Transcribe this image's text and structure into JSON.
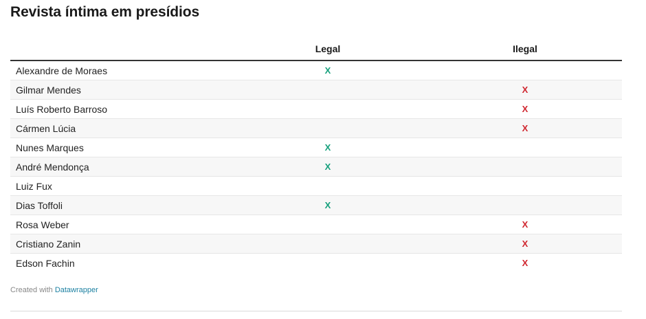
{
  "title": "Revista íntima em presídios",
  "chart_data": {
    "type": "table",
    "columns": [
      "",
      "Legal",
      "Ilegal"
    ],
    "rows": [
      {
        "name": "Alexandre de Moraes",
        "legal": "X",
        "ilegal": ""
      },
      {
        "name": "Gilmar Mendes",
        "legal": "",
        "ilegal": "X"
      },
      {
        "name": "Luís Roberto Barroso",
        "legal": "",
        "ilegal": "X"
      },
      {
        "name": "Cármen Lúcia",
        "legal": "",
        "ilegal": "X"
      },
      {
        "name": "Nunes Marques",
        "legal": "X",
        "ilegal": ""
      },
      {
        "name": "André Mendonça",
        "legal": "X",
        "ilegal": ""
      },
      {
        "name": "Luiz Fux",
        "legal": "",
        "ilegal": ""
      },
      {
        "name": "Dias Toffoli",
        "legal": "X",
        "ilegal": ""
      },
      {
        "name": "Rosa Weber",
        "legal": "",
        "ilegal": "X"
      },
      {
        "name": "Cristiano Zanin",
        "legal": "",
        "ilegal": "X"
      },
      {
        "name": "Edson Fachin",
        "legal": "",
        "ilegal": "X"
      }
    ]
  },
  "colors": {
    "legal": "#15a07c",
    "ilegal": "#d0262f",
    "link": "#1d81a2"
  },
  "footer": {
    "prefix": "Created with ",
    "link_label": "Datawrapper"
  }
}
